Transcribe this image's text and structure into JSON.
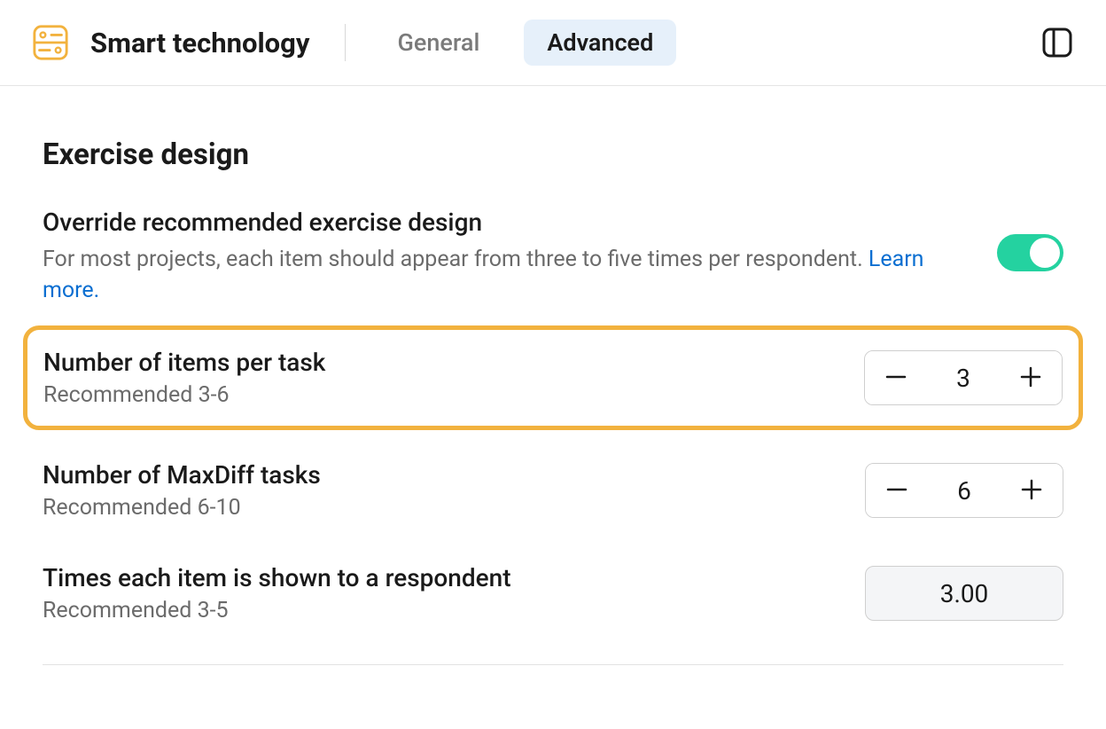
{
  "header": {
    "title": "Smart technology",
    "tabs": [
      {
        "label": "General",
        "active": false
      },
      {
        "label": "Advanced",
        "active": true
      }
    ]
  },
  "icons": {
    "app": "smart-technology-icon",
    "panel": "panel-toggle-icon",
    "minus": "minus-icon",
    "plus": "plus-icon"
  },
  "colors": {
    "accent_orange": "#f2b23e",
    "toggle_on": "#24d2a0",
    "tab_active_bg": "#e6f0fa",
    "link": "#0a6ed1"
  },
  "section": {
    "title": "Exercise design",
    "override": {
      "title": "Override recommended exercise design",
      "description": "For most projects, each item should appear from three to five times per respondent. ",
      "learn_more": "Learn more.",
      "enabled": true
    },
    "settings": [
      {
        "key": "items_per_task",
        "title": "Number of items per task",
        "help": "Recommended 3-6",
        "value": "3",
        "type": "stepper",
        "highlighted": true
      },
      {
        "key": "maxdiff_tasks",
        "title": "Number of MaxDiff tasks",
        "help": "Recommended 6-10",
        "value": "6",
        "type": "stepper",
        "highlighted": false
      },
      {
        "key": "times_shown",
        "title": "Times each item is shown to a respondent",
        "help": "Recommended 3-5",
        "value": "3.00",
        "type": "readonly",
        "highlighted": false
      }
    ]
  }
}
